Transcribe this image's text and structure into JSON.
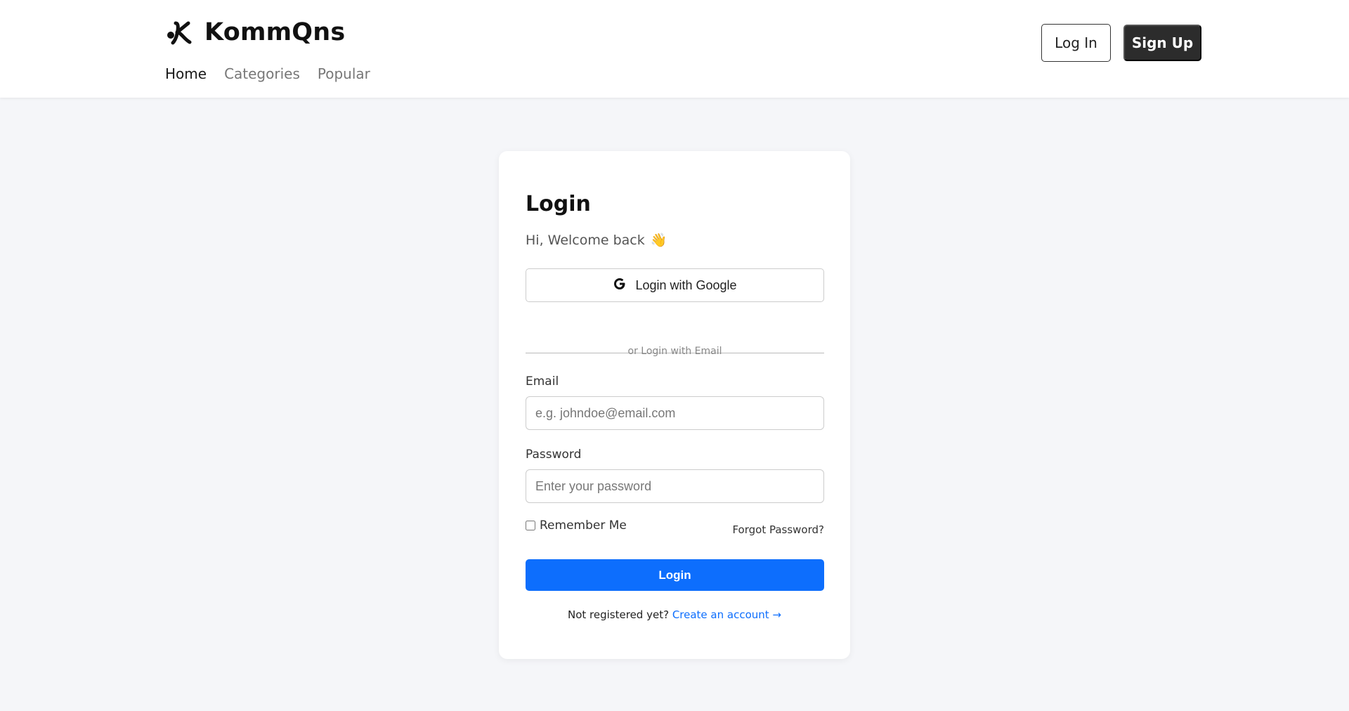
{
  "header": {
    "brand_name": "KommQns",
    "nav": [
      {
        "label": "Home",
        "active": true
      },
      {
        "label": "Categories",
        "active": false
      },
      {
        "label": "Popular",
        "active": false
      }
    ],
    "login_label": "Log In",
    "signup_label": "Sign Up"
  },
  "login_card": {
    "title": "Login",
    "subtitle": "Hi, Welcome back",
    "subtitle_emoji": "👋",
    "google_button_label": "Login with Google",
    "divider_text": "or Login with Email",
    "email_label": "Email",
    "email_placeholder": "e.g. johndoe@email.com",
    "email_value": "",
    "password_label": "Password",
    "password_placeholder": "Enter your password",
    "password_value": "",
    "remember_label": "Remember Me",
    "remember_checked": false,
    "forgot_label": "Forgot Password?",
    "submit_label": "Login",
    "register_prompt": "Not registered yet?",
    "register_link": "Create an account →"
  },
  "colors": {
    "page_background": "#f5f6f9",
    "primary": "#0d6efd",
    "dark_button": "#2c2c2c"
  },
  "icons": {
    "logo": "k-logo-icon",
    "google": "google-g-icon",
    "wave": "waving-hand-icon"
  }
}
